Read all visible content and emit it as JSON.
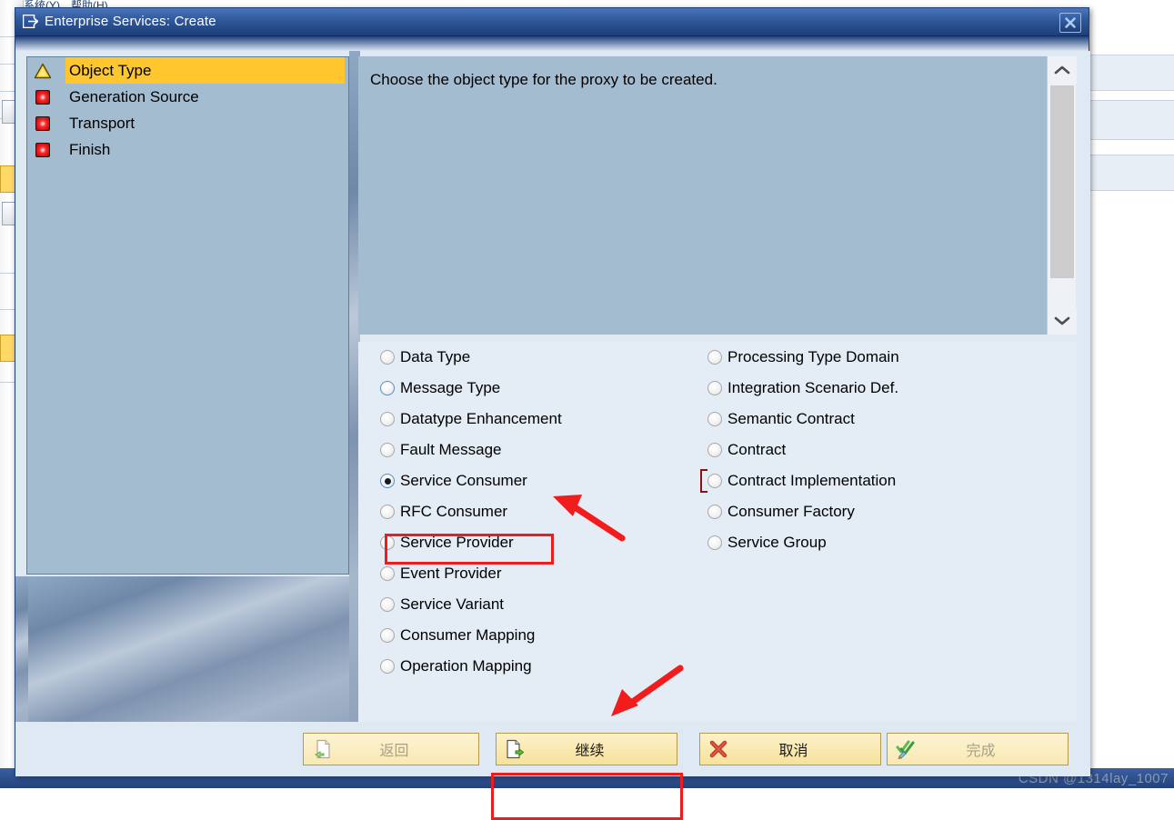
{
  "window": {
    "title": "Enterprise Services: Create",
    "title_icon": "sap-transaction-icon",
    "close_icon": "close-icon",
    "close_label": "X"
  },
  "wizard": {
    "steps": [
      {
        "label": "Object Type",
        "icon": "warning-triangle-icon",
        "state": "active"
      },
      {
        "label": "Generation Source",
        "icon": "red-square-icon",
        "state": "pending"
      },
      {
        "label": "Transport",
        "icon": "red-square-icon",
        "state": "pending"
      },
      {
        "label": "Finish",
        "icon": "red-square-icon",
        "state": "pending"
      }
    ]
  },
  "description": {
    "text": "Choose the object type for the proxy to be created.",
    "scrollbar": {
      "up_icon": "chevron-up-icon",
      "down_icon": "chevron-down-icon"
    }
  },
  "options": {
    "selected": "Service Consumer",
    "focused": "Contract Implementation",
    "left_column": [
      {
        "label": "Data Type",
        "checked": false
      },
      {
        "label": "Message Type",
        "checked": false,
        "focus_ring": true
      },
      {
        "label": "Datatype Enhancement",
        "checked": false
      },
      {
        "label": "Fault Message",
        "checked": false
      },
      {
        "label": "Service Consumer",
        "checked": true
      },
      {
        "label": "RFC Consumer",
        "checked": false
      },
      {
        "label": "Service Provider",
        "checked": false
      },
      {
        "label": "Event Provider",
        "checked": false
      },
      {
        "label": "Service Variant",
        "checked": false
      },
      {
        "label": "Consumer Mapping",
        "checked": false
      },
      {
        "label": "Operation Mapping",
        "checked": false
      }
    ],
    "right_column": [
      {
        "label": "Processing Type Domain",
        "checked": false
      },
      {
        "label": "Integration Scenario Def.",
        "checked": false
      },
      {
        "label": "Semantic Contract",
        "checked": false
      },
      {
        "label": "Contract",
        "checked": false
      },
      {
        "label": "Contract Implementation",
        "checked": false,
        "focus_bracket": true
      },
      {
        "label": "Consumer Factory",
        "checked": false
      },
      {
        "label": "Service Group",
        "checked": false
      }
    ]
  },
  "buttons": {
    "back": {
      "label": "返回",
      "icon": "back-page-icon",
      "enabled": false
    },
    "next": {
      "label": "继续",
      "icon": "next-page-icon",
      "enabled": true,
      "highlighted": true
    },
    "cancel": {
      "label": "取消",
      "icon": "red-x-icon",
      "enabled": true
    },
    "finish": {
      "label": "完成",
      "icon": "check-pencil-icon",
      "enabled": false
    }
  },
  "annotations": {
    "arrow_to_selected_option": "red-arrow-icon",
    "arrow_to_continue_button": "red-arrow-icon",
    "highlight_color": "#ee1c1c"
  },
  "watermark": {
    "text": "CSDN @1314lay_1007"
  },
  "colors": {
    "title_bar": "#2f5799",
    "panel": "#a3bcd0",
    "options_bg": "#e4ecf5",
    "step_active": "#ffc62e",
    "button": "#f6e29a"
  }
}
